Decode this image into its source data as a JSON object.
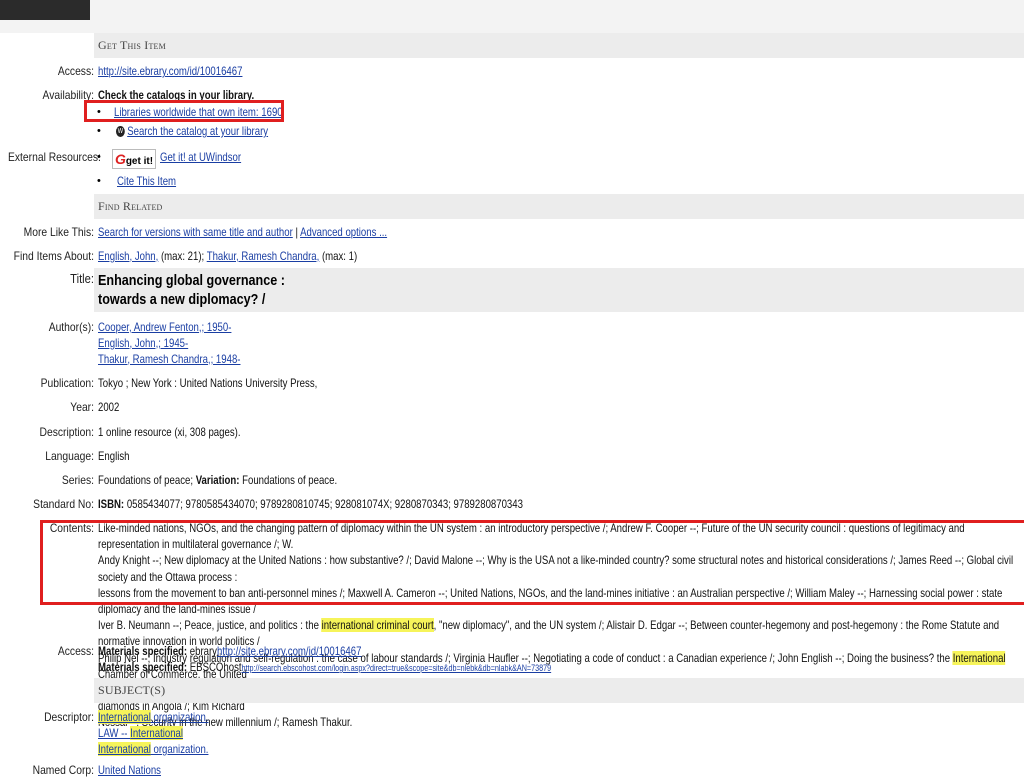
{
  "get_item": {
    "heading": "Get This Item",
    "access_label": "Access:",
    "access_link": "http://site.ebrary.com/id/10016467",
    "availability_label": "Availability:",
    "availability_text": "Check the catalogs in your library.",
    "libraries_link": "Libraries worldwide that own item: 1690",
    "search_catalog_link": "Search the catalog at your library",
    "external_label": "External Resources:",
    "getit_icon_text": "get it!",
    "getit_link": "Get it! at UWindsor",
    "cite_link": "Cite This Item"
  },
  "find_related": {
    "heading": "Find Related",
    "more_like_label": "More Like This:",
    "search_versions_link": "Search for versions with same title and author",
    "separator": "|",
    "advanced_link": "Advanced options ...",
    "find_items_label": "Find Items About:",
    "author1_link": "English, John,",
    "author1_max": "(max: 21);",
    "author2_link": "Thakur, Ramesh Chandra,",
    "author2_max": "(max: 1)"
  },
  "record": {
    "title_label": "Title:",
    "title_line1": "Enhancing global governance :",
    "title_line2": "towards a new diplomacy? /",
    "authors_label": "Author(s):",
    "authors": [
      "Cooper, Andrew Fenton,; 1950-",
      "English, John,; 1945-",
      "Thakur, Ramesh Chandra,; 1948-"
    ],
    "publication_label": "Publication:",
    "publication": "Tokyo ; New York : United Nations University Press,",
    "year_label": "Year:",
    "year": "2002",
    "description_label": "Description:",
    "description": "1 online resource (xi, 308 pages).",
    "language_label": "Language:",
    "language": "English",
    "series_label": "Series:",
    "series": "Foundations of peace;",
    "variation_label": "Variation:",
    "variation": "Foundations of peace.",
    "standard_label": "Standard No:",
    "isbn_label": "ISBN:",
    "isbn": "0585434077; 9780585434070; 9789280810745; 928081074X; 9280870343; 9789280870343",
    "contents_label": "Contents:",
    "contents_1": "Like-minded nations, NGOs, and the changing pattern of diplomacy within the UN system : an introductory perspective /; Andrew F. Cooper --; Future of the UN security council : questions of legitimacy and representation in multilateral governance /; W.",
    "contents_2": "Andy Knight --; New diplomacy at the United Nations : how substantive? /; David Malone --; Why is the USA not a like-minded country? some structural notes and historical considerations /; James Reed --; Global civil society and the Ottawa process :",
    "contents_3": "lessons from the movement to ban anti-personnel mines /; Maxwell A. Cameron --; United Nations, NGOs, and the land-mines initiative : an Australian perspective /; William Maley --; Harnessing social power : state diplomacy and the land-mines issue /",
    "contents_4a": "Iver B. Neumann --; Peace, justice, and politics : the ",
    "contents_4hl": "international criminal court",
    "contents_4b": ", \"new diplomacy\", and the UN system /; Alistair D. Edgar --; Between counter-hegemony and post-hegemony : the Rome Statute and normative innovation in world politics /",
    "contents_5a": "Philip Nel --; Industry regulation and self-regulation : the case of labour standards /; Virginia Haufler --; Negotiating a code of conduct : a Canadian experience /; John English --; Doing the business? the ",
    "contents_5hl": "International",
    "contents_5b": " Chamber of Commerce, the United",
    "contents_6": "Nations, and the global compact /; Brian Hocking, Dominic Kelly --; Codes of conduct and children in armed conflicts /; Deirdre Van der Merwe, Mark Malan --; Smarter, sharper, stronger? UN sanctions and conflict diamonds in Angola /; Kim Richard",
    "contents_7": "Nossal --; Security in the new millennium /; Ramesh Thakur.",
    "access2_label": "Access:",
    "materials_label": "Materials specified:",
    "materials1_prefix": "ebrary",
    "materials1_link": "http://site.ebrary.com/id/10016467",
    "materials2_prefix": "EBSCOhost",
    "materials2_link": "http://search.ebscohost.com/login.aspx?direct=true&scope=site&db=nlebk&db=nlabk&AN=73879"
  },
  "subjects": {
    "heading": "SUBJECT(S)",
    "descriptor_label": "Descriptor:",
    "items": [
      {
        "hl": "International",
        "rest": " organization."
      },
      {
        "pre": "LAW -- ",
        "hl": "International",
        "rest": ""
      },
      {
        "hl": "International",
        "rest": " organization."
      }
    ],
    "cut_label": "Named Corp:",
    "cut_value": "United Nations"
  },
  "colors": {
    "highlight": "#f6f45a",
    "annotation_box": "#e01f1f",
    "link": "#1a3ea3",
    "section_bg": "#ececec"
  }
}
